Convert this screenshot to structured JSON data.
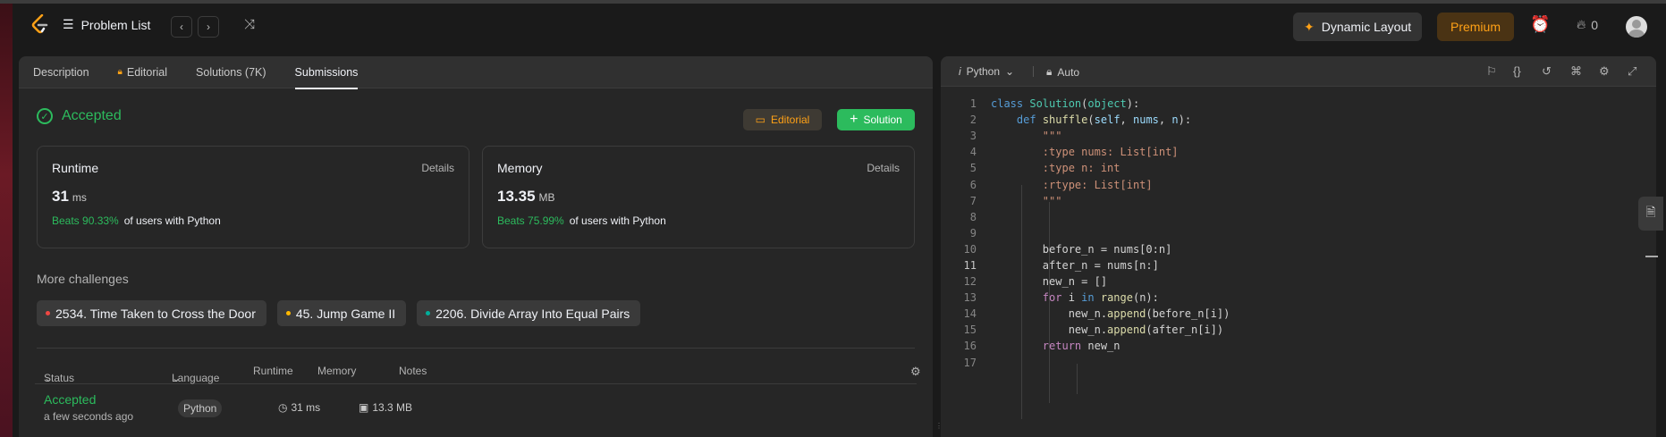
{
  "topbar": {
    "problem_list_label": "Problem List",
    "prev_icon": "chevron-left-icon",
    "next_icon": "chevron-right-icon",
    "shuffle_icon": "shuffle-icon",
    "dynamic_layout_label": "Dynamic Layout",
    "premium_label": "Premium",
    "streak_count": "0"
  },
  "left_panel": {
    "tabs": [
      {
        "label": "Description"
      },
      {
        "label": "Editorial"
      },
      {
        "label": "Solutions (7K)"
      },
      {
        "label": "Submissions"
      }
    ],
    "active_tab": "Submissions",
    "status": "Accepted",
    "editorial_button": "Editorial",
    "solution_button": "Solution",
    "runtime": {
      "title": "Runtime",
      "details": "Details",
      "value": "31",
      "unit": "ms",
      "beats_pct": "Beats 90.33%",
      "beats_suffix": "of users with Python"
    },
    "memory": {
      "title": "Memory",
      "details": "Details",
      "value": "13.35",
      "unit": "MB",
      "beats_pct": "Beats 75.99%",
      "beats_suffix": "of users with Python"
    },
    "more_challenges_title": "More challenges",
    "challenges": [
      {
        "label": "2534. Time Taken to Cross the Door",
        "color": "#ef4743"
      },
      {
        "label": "45. Jump Game II",
        "color": "#ffb800"
      },
      {
        "label": "2206. Divide Array Into Equal Pairs",
        "color": "#00af9b"
      }
    ],
    "table": {
      "headers": {
        "status": "Status",
        "language": "Language",
        "runtime": "Runtime",
        "memory": "Memory",
        "notes": "Notes"
      },
      "rows": [
        {
          "status": "Accepted",
          "time": "a few seconds ago",
          "language": "Python",
          "runtime": "31 ms",
          "memory": "13.3 MB"
        }
      ]
    }
  },
  "editor": {
    "language": "Python",
    "auto_label": "Auto",
    "lines": [
      "1",
      "2",
      "3",
      "4",
      "5",
      "6",
      "7",
      "8",
      "9",
      "10",
      "11",
      "12",
      "13",
      "14",
      "15",
      "16",
      "17"
    ],
    "current_line": "11"
  }
}
